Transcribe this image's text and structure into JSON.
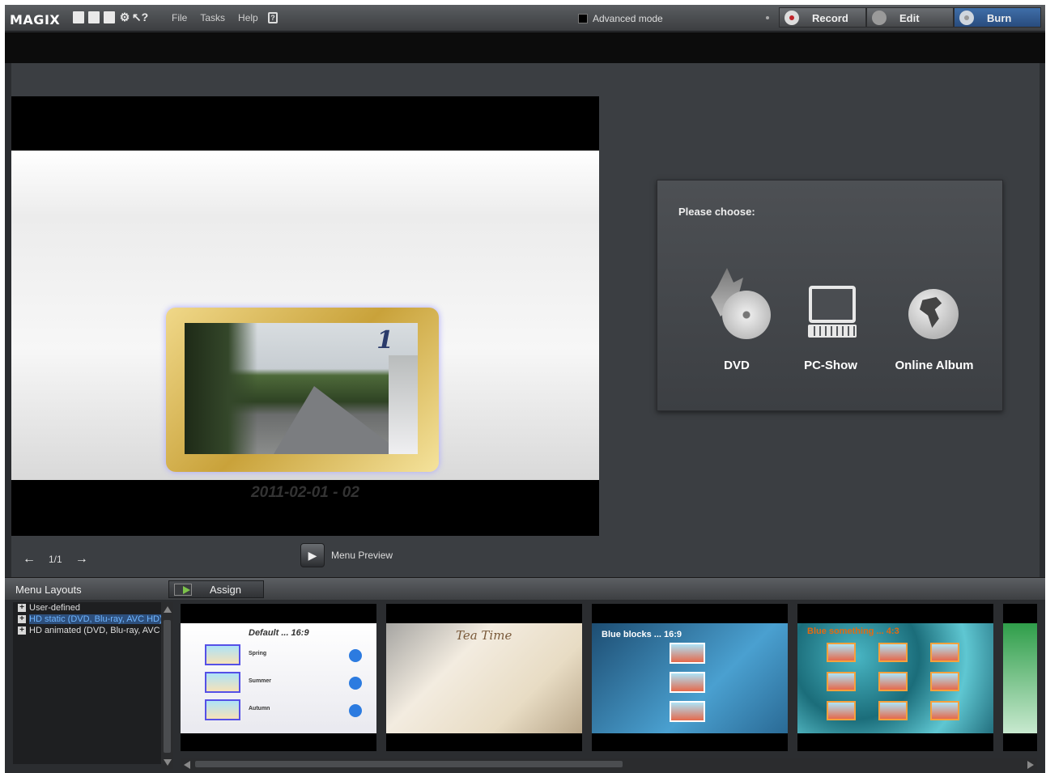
{
  "app": {
    "logo": "MAGIX"
  },
  "toolbar": {
    "icons": [
      "new-file-icon",
      "open-folder-icon",
      "save-icon",
      "settings-icon",
      "help-pointer-icon"
    ],
    "menu": [
      "File",
      "Tasks",
      "Help"
    ],
    "advanced_mode_label": "Advanced mode",
    "modes": [
      {
        "label": "Record",
        "icon": "record-icon",
        "active": false
      },
      {
        "label": "Edit",
        "icon": "film-reel-icon",
        "active": false
      },
      {
        "label": "Burn",
        "icon": "disc-icon",
        "active": true
      }
    ]
  },
  "preview": {
    "caption": "2011-02-01 - 02",
    "chapter_number": "1",
    "page_indicator": "1/1",
    "menu_preview_label": "Menu Preview"
  },
  "choose": {
    "title": "Please choose:",
    "options": [
      {
        "label": "DVD",
        "icon": "dvd-burn-icon"
      },
      {
        "label": "PC-Show",
        "icon": "computer-icon"
      },
      {
        "label": "Online Album",
        "icon": "globe-icon"
      }
    ]
  },
  "menu_layouts": {
    "title": "Menu Layouts",
    "assign_label": "Assign",
    "tree": [
      {
        "label": "User-defined",
        "selected": false
      },
      {
        "label": "HD static (DVD, Blu-ray, AVC HD)",
        "selected": true
      },
      {
        "label": "HD animated (DVD, Blu-ray, AVC HD)",
        "selected": false
      }
    ],
    "thumbnails": [
      {
        "title": "Default ... 16:9",
        "items": [
          "Spring",
          "Summer",
          "Autumn"
        ]
      },
      {
        "title": "Tea Time"
      },
      {
        "title": "Blue blocks ... 16:9"
      },
      {
        "title": "Blue something ... 4:3"
      },
      {
        "title": ""
      }
    ]
  },
  "colors": {
    "accent": "#2d5a91",
    "selection_text": "#6fb5ff",
    "background": "#3b3e42"
  }
}
